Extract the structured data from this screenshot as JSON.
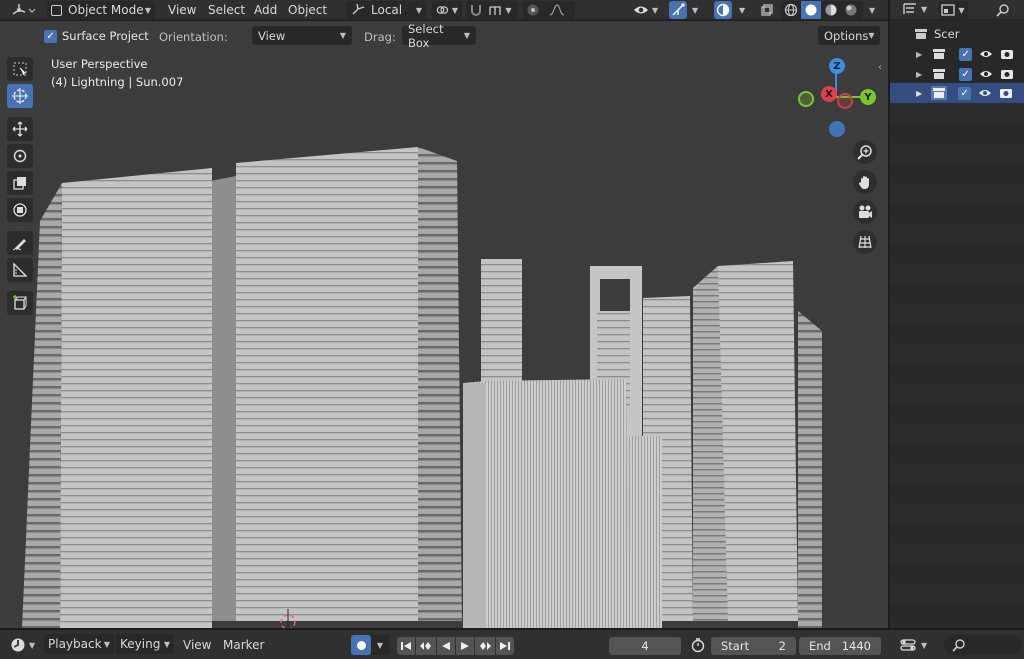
{
  "header": {
    "mode_label": "Object Mode",
    "menus": [
      "View",
      "Select",
      "Add",
      "Object"
    ],
    "transform_orientation": "Local",
    "icons": [
      "editor-type-icon",
      "object-mode-icon",
      "orientation-icon",
      "pivot-icon",
      "snap-icon",
      "snap-target-icon",
      "proportional-icon",
      "falloff-icon",
      "visibility-icon",
      "gizmo-icon",
      "overlay-icon",
      "xray-icon",
      "wireframe-shading-icon",
      "solid-shading-icon",
      "material-shading-icon",
      "rendered-shading-icon"
    ]
  },
  "tool_settings": {
    "surface_project_label": "Surface Project",
    "surface_project_checked": true,
    "orientation_label": "Orientation:",
    "orientation_value": "View",
    "drag_label": "Drag:",
    "drag_value": "Select Box",
    "options_label": "Options"
  },
  "viewport": {
    "perspective_text": "User Perspective",
    "object_text": "(4) Lightning | Sun.007",
    "gizmo": {
      "z": "Z",
      "x": "X",
      "y": "Y"
    },
    "tools": [
      "select-box-icon",
      "cursor-icon",
      "move-icon",
      "rotate-icon",
      "scale-icon",
      "transform-icon",
      "annotate-icon",
      "measure-icon",
      "add-cube-icon"
    ],
    "nav_buttons": [
      "zoom-icon",
      "pan-hand-icon",
      "camera-view-icon",
      "ortho-grid-icon"
    ]
  },
  "outliner": {
    "root_label": "Scer",
    "rows": [
      {
        "checked": true,
        "visible": true,
        "renderable": true,
        "selected": false
      },
      {
        "checked": true,
        "visible": true,
        "renderable": true,
        "selected": false
      },
      {
        "checked": true,
        "visible": true,
        "renderable": true,
        "selected": true
      }
    ]
  },
  "timeline": {
    "playback_label": "Playback",
    "keying_label": "Keying",
    "view_label": "View",
    "marker_label": "Marker",
    "current_frame": "4",
    "start_label": "Start",
    "start_value": "2",
    "end_label": "End",
    "end_value": "1440"
  },
  "colors": {
    "accent": "#4772b3",
    "axis_x": "#e0404a",
    "axis_y": "#7bc72a",
    "axis_z": "#3d8de0",
    "background": "#3c3c3c",
    "buildings": "#bdbdbd"
  }
}
